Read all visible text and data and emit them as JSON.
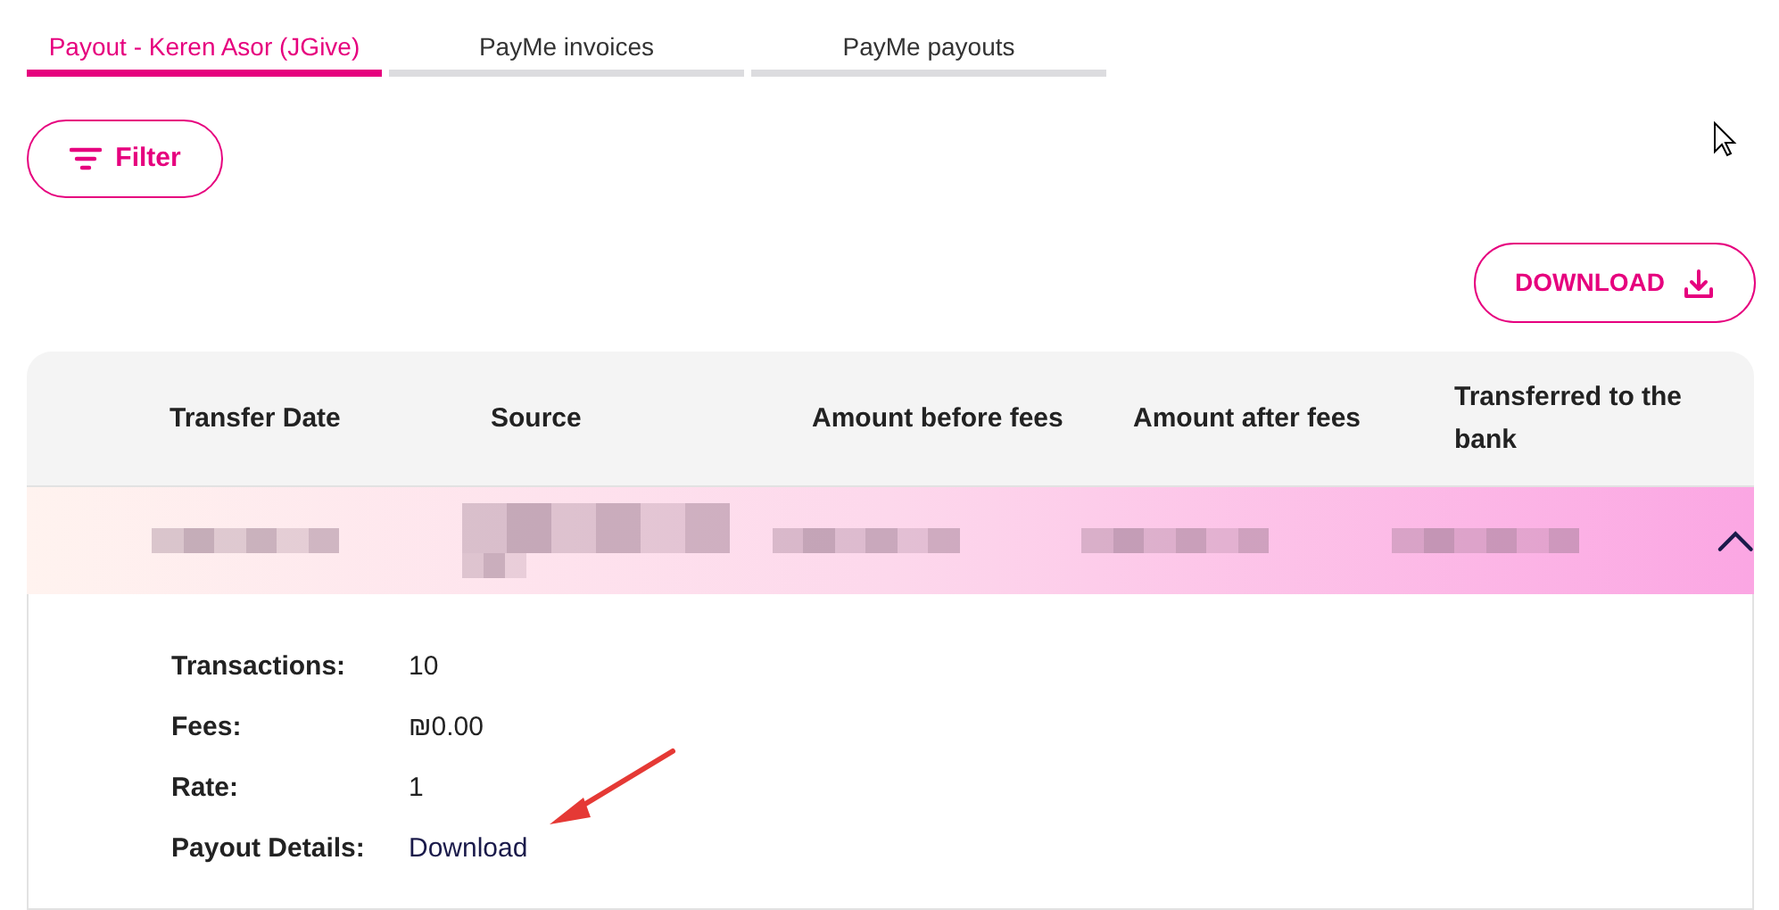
{
  "tabs": [
    {
      "label": "Payout - Keren Asor (JGive)",
      "selected": true
    },
    {
      "label": "PayMe invoices",
      "selected": false
    },
    {
      "label": "PayMe payouts",
      "selected": false
    }
  ],
  "filter_button": {
    "label": "Filter"
  },
  "download_button": {
    "label": "DOWNLOAD"
  },
  "table": {
    "columns": [
      "Transfer Date",
      "Source",
      "Amount before fees",
      "Amount after fees",
      "Transferred to the bank"
    ],
    "rows": [
      {
        "expanded": true,
        "cells": [
          {
            "kind": "redacted"
          },
          {
            "kind": "redacted"
          },
          {
            "kind": "redacted"
          },
          {
            "kind": "redacted"
          },
          {
            "kind": "redacted"
          }
        ],
        "details": [
          {
            "label": "Transactions:",
            "value": "10",
            "kind": "text"
          },
          {
            "label": "Fees:",
            "value": "₪0.00",
            "kind": "text"
          },
          {
            "label": "Rate:",
            "value": "1",
            "kind": "text"
          },
          {
            "label": "Payout Details:",
            "value": "Download",
            "kind": "link"
          }
        ]
      }
    ]
  }
}
